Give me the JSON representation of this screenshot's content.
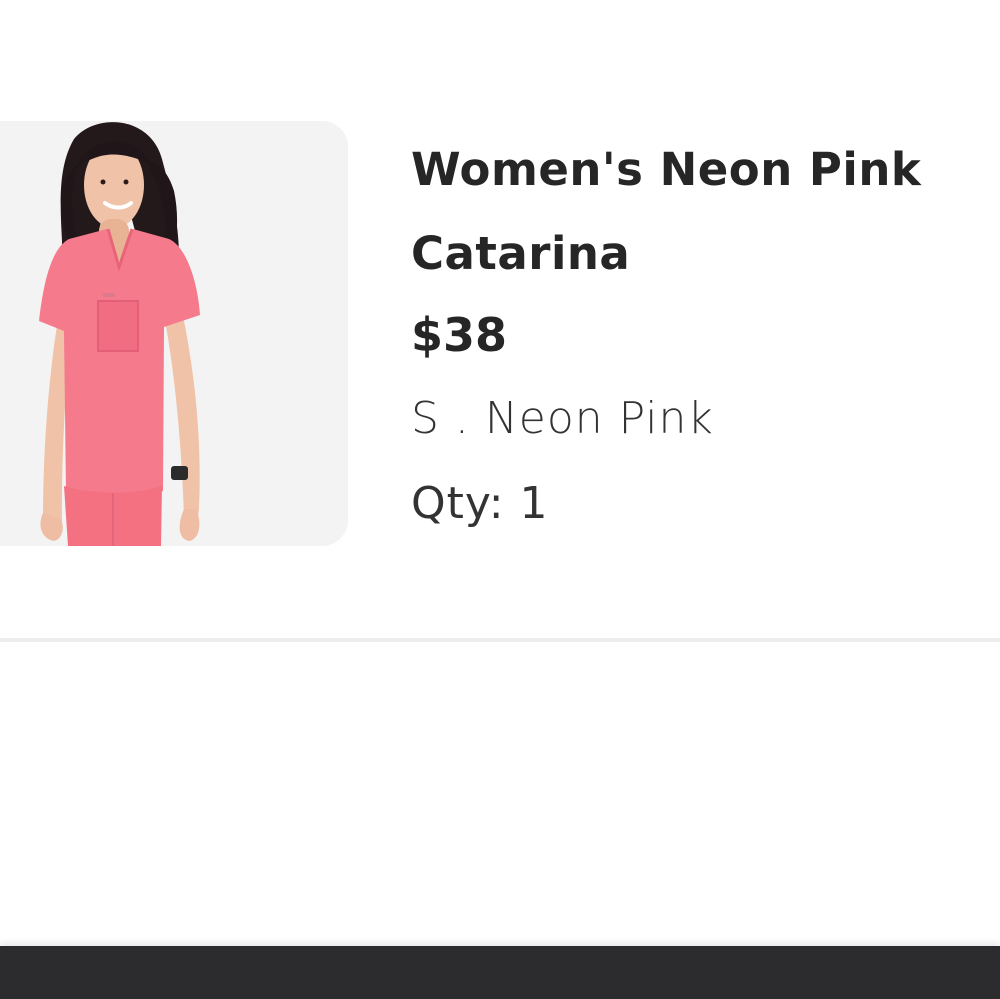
{
  "cart_item": {
    "title": "Women's Neon Pink Catarina",
    "price": "$38",
    "variant": "S . Neon Pink",
    "quantity": "Qty: 1",
    "image_icon": "product-photo"
  },
  "colors": {
    "text": "#262626",
    "image_background": "#f3f3f3",
    "scrub_pink": "#f47a8c",
    "bottom_bar": "#2c2c2e"
  }
}
